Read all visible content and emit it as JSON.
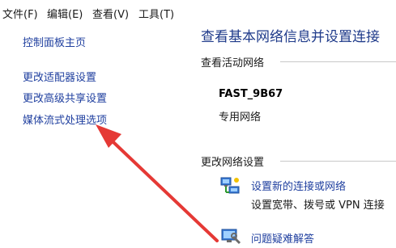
{
  "menubar": {
    "items": [
      {
        "label": "文件(F)"
      },
      {
        "label": "编辑(E)"
      },
      {
        "label": "查看(V)"
      },
      {
        "label": "工具(T)"
      }
    ]
  },
  "sidebar": {
    "links": [
      {
        "label": "控制面板主页"
      },
      {
        "label": "更改适配器设置"
      },
      {
        "label": "更改高级共享设置"
      },
      {
        "label": "媒体流式处理选项"
      }
    ]
  },
  "main": {
    "title": "查看基本网络信息并设置连接",
    "active_section": "查看活动网络",
    "network_name": "FAST_9B67",
    "network_type": "专用网络",
    "change_section": "更改网络设置",
    "actions": [
      {
        "link": "设置新的连接或网络",
        "desc": "设置宽带、拨号或 VPN 连接",
        "icon": "network-setup-icon"
      },
      {
        "link": "问题疑难解答",
        "icon": "troubleshoot-icon"
      }
    ]
  },
  "annotation": {
    "color": "#e53935"
  }
}
